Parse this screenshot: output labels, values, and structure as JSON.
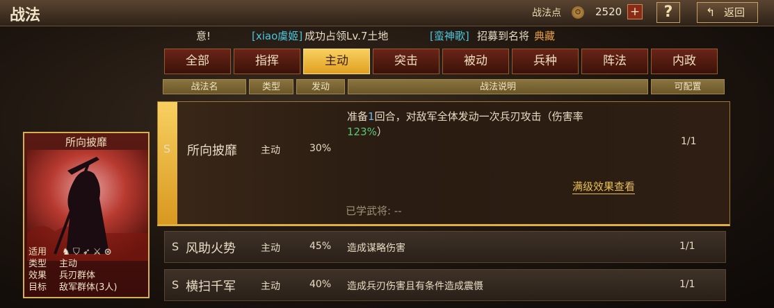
{
  "header": {
    "title": "战法",
    "points_label": "战法点",
    "coin_glyph": "⚙",
    "points_value": "2520",
    "plus_label": "+",
    "help_label": "?",
    "back_label": "返回"
  },
  "ticker": {
    "prefix": "意!",
    "user1": "[xiao虞姬]",
    "msg1": "成功占领Lv.7土地",
    "user2": "[蛮神歌]",
    "msg2": "招募到名将",
    "item": "典藏"
  },
  "tabs": [
    "全部",
    "指挥",
    "主动",
    "突击",
    "被动",
    "兵种",
    "阵法",
    "内政"
  ],
  "active_tab_index": 2,
  "columns": {
    "name": "战法名",
    "type": "类型",
    "trigger": "发动",
    "desc": "战法说明",
    "config": "可配置"
  },
  "selected": {
    "grade": "S",
    "name": "所向披靡",
    "type": "主动",
    "rate": "30%",
    "desc_a": "准备",
    "desc_num": "1",
    "desc_b": "回合，对敌军全体发动一次兵刃攻击（伤害率",
    "desc_pct": "123%",
    "desc_c": "）",
    "config": "1/1",
    "max_link": "满级效果查看",
    "learned": "已学武将: --"
  },
  "rows": [
    {
      "grade": "S",
      "name": "风助火势",
      "type": "主动",
      "rate": "45%",
      "desc": "造成谋略伤害",
      "config": "1/1"
    },
    {
      "grade": "S",
      "name": "横扫千军",
      "type": "主动",
      "rate": "40%",
      "desc": "造成兵刃伤害且有条件造成震慑",
      "config": "1/1"
    }
  ],
  "card": {
    "title": "所向披靡",
    "applies_label": "适用",
    "type_label": "类型",
    "type_value": "主动",
    "effect_label": "效果",
    "effect_value": "兵刃群体",
    "target_label": "目标",
    "target_value": "敌军群体(3人)"
  },
  "colors": {
    "accent_gold": "#e0a020",
    "tab_red": "#6a2418",
    "link_gold": "#e8c050",
    "highlight_green": "#58c878",
    "highlight_blue": "#68b8f0",
    "ticker_cyan": "#48c8e0",
    "ticker_orange": "#e8a040"
  }
}
